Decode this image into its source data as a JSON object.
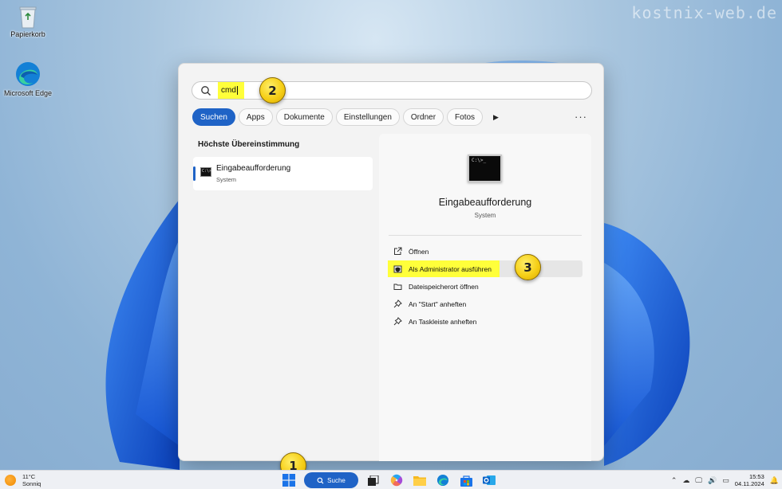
{
  "watermark": "kostnix-web.de",
  "desktop": {
    "icons": [
      {
        "label": "Papierkorb"
      },
      {
        "label": "Microsoft Edge"
      }
    ]
  },
  "search": {
    "query": "cmd",
    "filters": [
      "Suchen",
      "Apps",
      "Dokumente",
      "Einstellungen",
      "Ordner",
      "Fotos"
    ],
    "active_filter": "Suchen",
    "more_label": "···"
  },
  "best_match": {
    "title": "Höchste Übereinstimmung",
    "name": "Eingabeaufforderung",
    "type": "System"
  },
  "detail": {
    "name": "Eingabeaufforderung",
    "type": "System",
    "actions": [
      {
        "label": "Öffnen",
        "icon": "open-icon"
      },
      {
        "label": "Als Administrator ausführen",
        "icon": "shield-icon"
      },
      {
        "label": "Dateispeicherort öffnen",
        "icon": "folder-icon"
      },
      {
        "label": "An \"Start\" anheften",
        "icon": "pin-icon"
      },
      {
        "label": "An Taskleiste anheften",
        "icon": "pin-icon"
      }
    ]
  },
  "badges": [
    "1",
    "2",
    "3"
  ],
  "taskbar": {
    "weather_temp": "11°C",
    "weather_text": "Sonniq",
    "search_label": "Suche",
    "time": "15:53",
    "date": "04.11.2024"
  },
  "colors": {
    "accent": "#1f63c6",
    "highlight": "#ffff3a",
    "badge": "#f6cf17"
  }
}
